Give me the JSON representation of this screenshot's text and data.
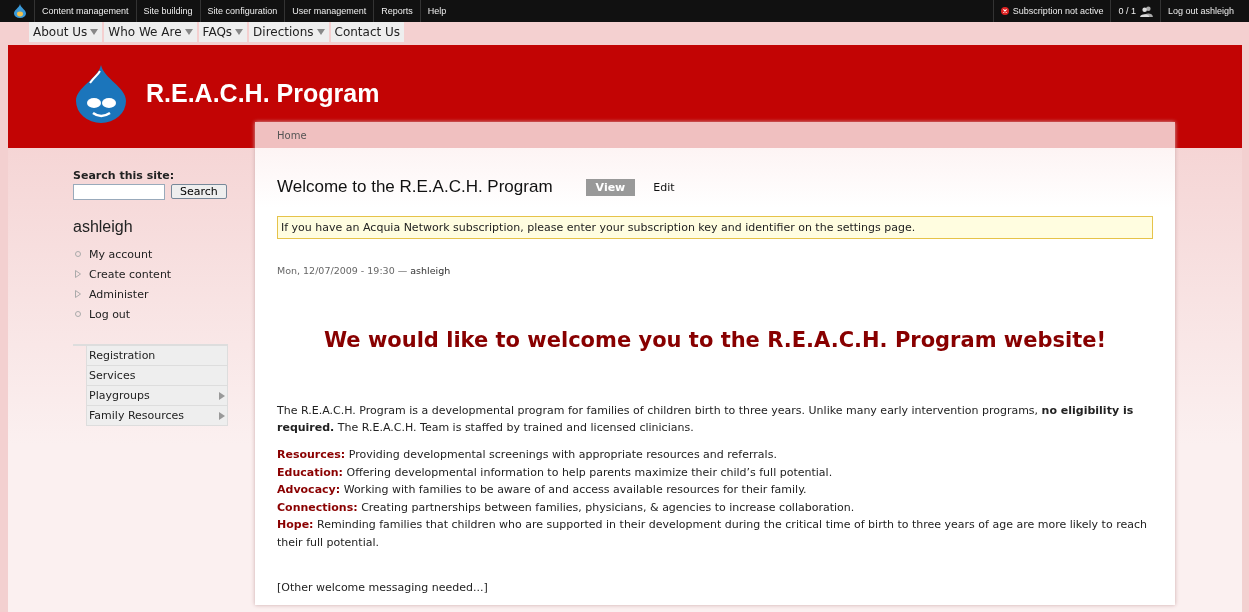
{
  "admin_bar": {
    "menu": [
      "Content management",
      "Site building",
      "Site configuration",
      "User management",
      "Reports",
      "Help"
    ],
    "subscription_status": "Subscription not active",
    "users_online": "0 / 1",
    "logout": "Log out ashleigh"
  },
  "primary_nav": [
    {
      "label": "About Us",
      "has_dropdown": true
    },
    {
      "label": "Who We Are",
      "has_dropdown": true
    },
    {
      "label": "FAQs",
      "has_dropdown": true
    },
    {
      "label": "Directions",
      "has_dropdown": true
    },
    {
      "label": "Contact Us",
      "has_dropdown": false
    }
  ],
  "site_name": "R.E.A.C.H. Program",
  "breadcrumb": [
    "Home"
  ],
  "sidebar": {
    "search": {
      "label": "Search this site:",
      "button": "Search"
    },
    "user_block": {
      "title": "ashleigh",
      "items": [
        {
          "label": "My account",
          "kind": "leaf"
        },
        {
          "label": "Create content",
          "kind": "collapsed"
        },
        {
          "label": "Administer",
          "kind": "collapsed"
        },
        {
          "label": "Log out",
          "kind": "leaf"
        }
      ]
    },
    "menu_block": [
      {
        "label": "Registration",
        "has_children": false
      },
      {
        "label": "Services",
        "has_children": false
      },
      {
        "label": "Playgroups",
        "has_children": true
      },
      {
        "label": "Family Resources",
        "has_children": true
      }
    ]
  },
  "page": {
    "title": "Welcome to the R.E.A.C.H. Program",
    "tabs": [
      {
        "label": "View",
        "selected": true
      },
      {
        "label": "Edit",
        "selected": false
      }
    ],
    "notice": "If you have an Acquia Network subscription, please enter your subscription key and identifier on the settings page.",
    "submitted": "Mon, 12/07/2009 - 19:30 —",
    "author": "ashleigh",
    "headline": "We would like to welcome you to the R.E.A.C.H. Program website!",
    "intro": "The R.E.A.C.H. Program is a developmental program for families of children birth to three years. Unlike many early intervention programs, **no eligibility is required.** The R.E.A.C.H. Team is staffed by trained and licensed clinicians.",
    "features": [
      "**Resources:** Providing developmental screenings with appropriate resources and referrals.",
      "**Education:** Offering developmental information to help parents maximize their child’s full potential.",
      "**Advocacy:** Working with families to be aware of and access available resources for their family.",
      "**Connections:** Creating partnerships between families, physicians, & agencies to increase collaboration.",
      "**Hope:** Reminding families that children who are supported in their development during the critical time of birth to three years of age are more likely to reach their full potential."
    ],
    "footer_note": "[Other welcome messaging needed...]"
  }
}
